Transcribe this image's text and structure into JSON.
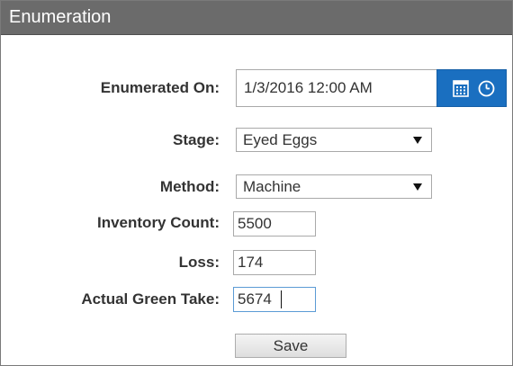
{
  "panel": {
    "title": "Enumeration"
  },
  "form": {
    "enumerated_on": {
      "label": "Enumerated On:",
      "value": "1/3/2016 12:00 AM"
    },
    "stage": {
      "label": "Stage:",
      "value": "Eyed Eggs"
    },
    "method": {
      "label": "Method:",
      "value": "Machine"
    },
    "inventory_count": {
      "label": "Inventory Count:",
      "value": "5500"
    },
    "loss": {
      "label": "Loss:",
      "value": "174"
    },
    "actual_green_take": {
      "label": "Actual Green Take:",
      "value": "5674"
    }
  },
  "actions": {
    "save_label": "Save"
  },
  "icons": {
    "date": "calendar-icon",
    "time": "clock-icon"
  },
  "colors": {
    "titlebar": "#6b6b6b",
    "accent": "#1a6fc0",
    "focus": "#5b9bd5"
  }
}
